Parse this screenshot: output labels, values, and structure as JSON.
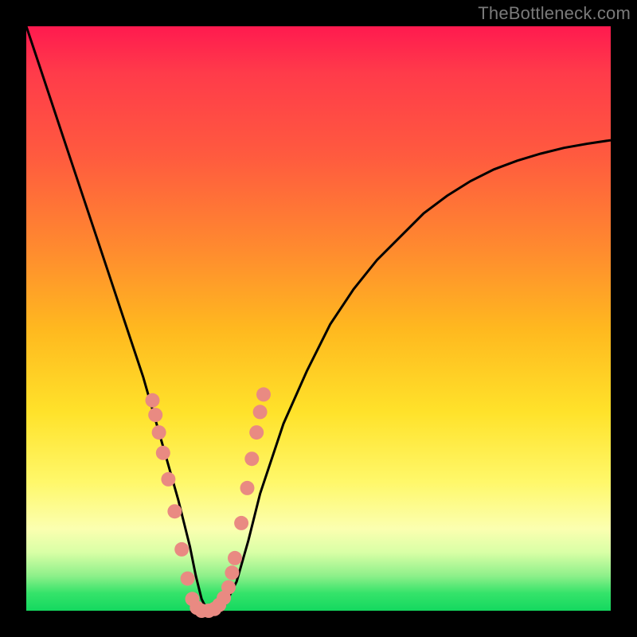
{
  "watermark": "TheBottleneck.com",
  "colors": {
    "frame": "#000000",
    "gradient_top": "#ff1a4f",
    "gradient_bottom": "#14d85f",
    "curve": "#000000",
    "dot": "#e98a82"
  },
  "chart_data": {
    "type": "line",
    "title": "",
    "xlabel": "",
    "ylabel": "",
    "xlim": [
      0,
      100
    ],
    "ylim": [
      0,
      100
    ],
    "grid": false,
    "legend": false,
    "curve_x": [
      0,
      2,
      4,
      6,
      8,
      10,
      12,
      14,
      16,
      18,
      20,
      22,
      24,
      26,
      28,
      29,
      30,
      31,
      32,
      33,
      34,
      36,
      38,
      40,
      44,
      48,
      52,
      56,
      60,
      64,
      68,
      72,
      76,
      80,
      84,
      88,
      92,
      96,
      100
    ],
    "curve_y": [
      100,
      94,
      88,
      82,
      76,
      70,
      64,
      58,
      52,
      46,
      40,
      33,
      26,
      19,
      11,
      6,
      2,
      0,
      0,
      0,
      1,
      5,
      12,
      20,
      32,
      41,
      49,
      55,
      60,
      64,
      68,
      71,
      73.5,
      75.5,
      77,
      78.2,
      79.2,
      79.9,
      80.5
    ],
    "dots_x": [
      21.6,
      22.1,
      22.7,
      23.4,
      24.3,
      25.4,
      26.6,
      27.6,
      28.4,
      29.2,
      30.0,
      31.2,
      32.2,
      33.0,
      33.8,
      34.6,
      35.2,
      35.7,
      36.8,
      37.8,
      38.6,
      39.4,
      40.0,
      40.6
    ],
    "dots_y": [
      36.0,
      33.5,
      30.5,
      27.0,
      22.5,
      17.0,
      10.5,
      5.5,
      2.0,
      0.5,
      0.0,
      0.0,
      0.3,
      1.0,
      2.2,
      4.0,
      6.5,
      9.0,
      15.0,
      21.0,
      26.0,
      30.5,
      34.0,
      37.0
    ],
    "annotations": []
  }
}
